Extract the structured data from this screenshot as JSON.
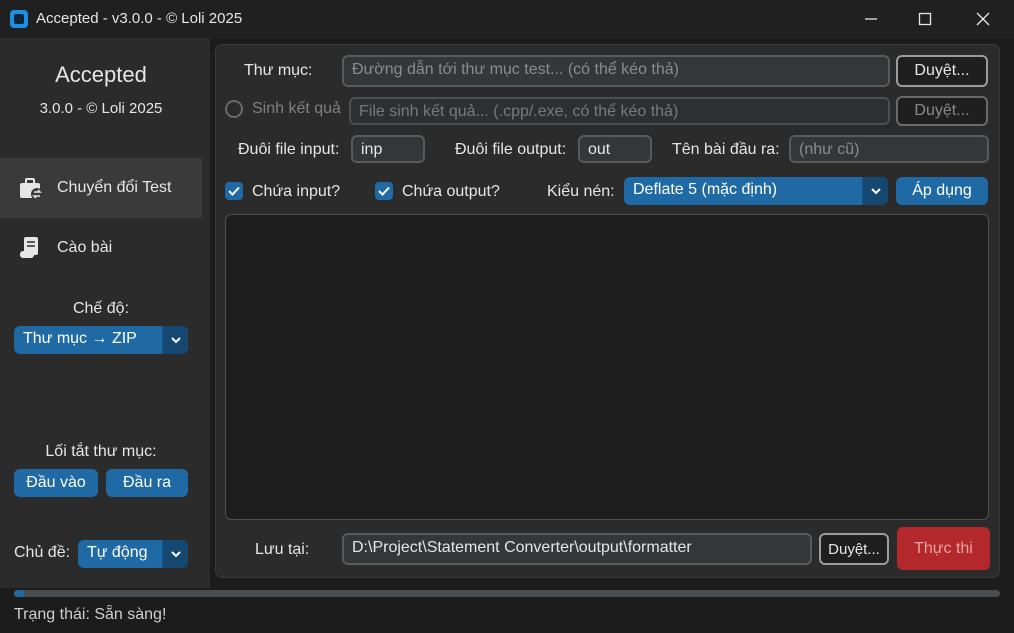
{
  "window": {
    "title": "Accepted - v3.0.0 - © Loli 2025",
    "minimize_glyph": "—",
    "maximize_glyph": "☐",
    "close_glyph": "✕"
  },
  "sidebar": {
    "app_name": "Accepted",
    "version_line": "3.0.0 - © Loli 2025",
    "nav": [
      {
        "label": "Chuyển đổi Test",
        "icon": "briefcase-convert-icon",
        "active": true
      },
      {
        "label": "Cào bài",
        "icon": "scroll-document-icon",
        "active": false
      }
    ],
    "mode_label": "Chế độ:",
    "mode_value": "Thư mục → ZIP",
    "shortcuts_label": "Lối tắt thư mục:",
    "shortcut_input": "Đầu vào",
    "shortcut_output": "Đầu ra",
    "theme_label": "Chủ đề:",
    "theme_value": "Tự động"
  },
  "main": {
    "folder_label": "Thư mục:",
    "folder_placeholder": "Đường dẫn tới thư mục test... (có thể kéo thả)",
    "browse_label": "Duyệt...",
    "gen_label": "Sinh kết quả",
    "gen_placeholder": "File sinh kết quả... (.cpp/.exe, có thể kéo thả)",
    "gen_browse_label": "Duyệt...",
    "input_ext_label": "Đuôi file input:",
    "input_ext_value": "inp",
    "output_ext_label": "Đuôi file output:",
    "output_ext_value": "out",
    "out_name_label": "Tên bài đầu ra:",
    "out_name_placeholder": "(như cũ)",
    "has_input_label": "Chứa input?",
    "has_input_checked": true,
    "has_output_label": "Chứa output?",
    "has_output_checked": true,
    "compress_label": "Kiểu nén:",
    "compress_value": "Deflate 5 (mặc định)",
    "apply_label": "Áp dụng",
    "log_text": "",
    "save_label": "Lưu tại:",
    "save_value": "D:\\Project\\Statement Converter\\output\\formatter",
    "save_browse_label": "Duyệt...",
    "run_label": "Thực thi"
  },
  "status": {
    "text": "Trạng thái: Sẵn sàng!",
    "progress": 0.01
  },
  "colors": {
    "accent": "#1f6aa5",
    "danger": "#b3282b",
    "sidebar_bg": "#2b2b2b",
    "window_bg": "#1c1c1c"
  }
}
